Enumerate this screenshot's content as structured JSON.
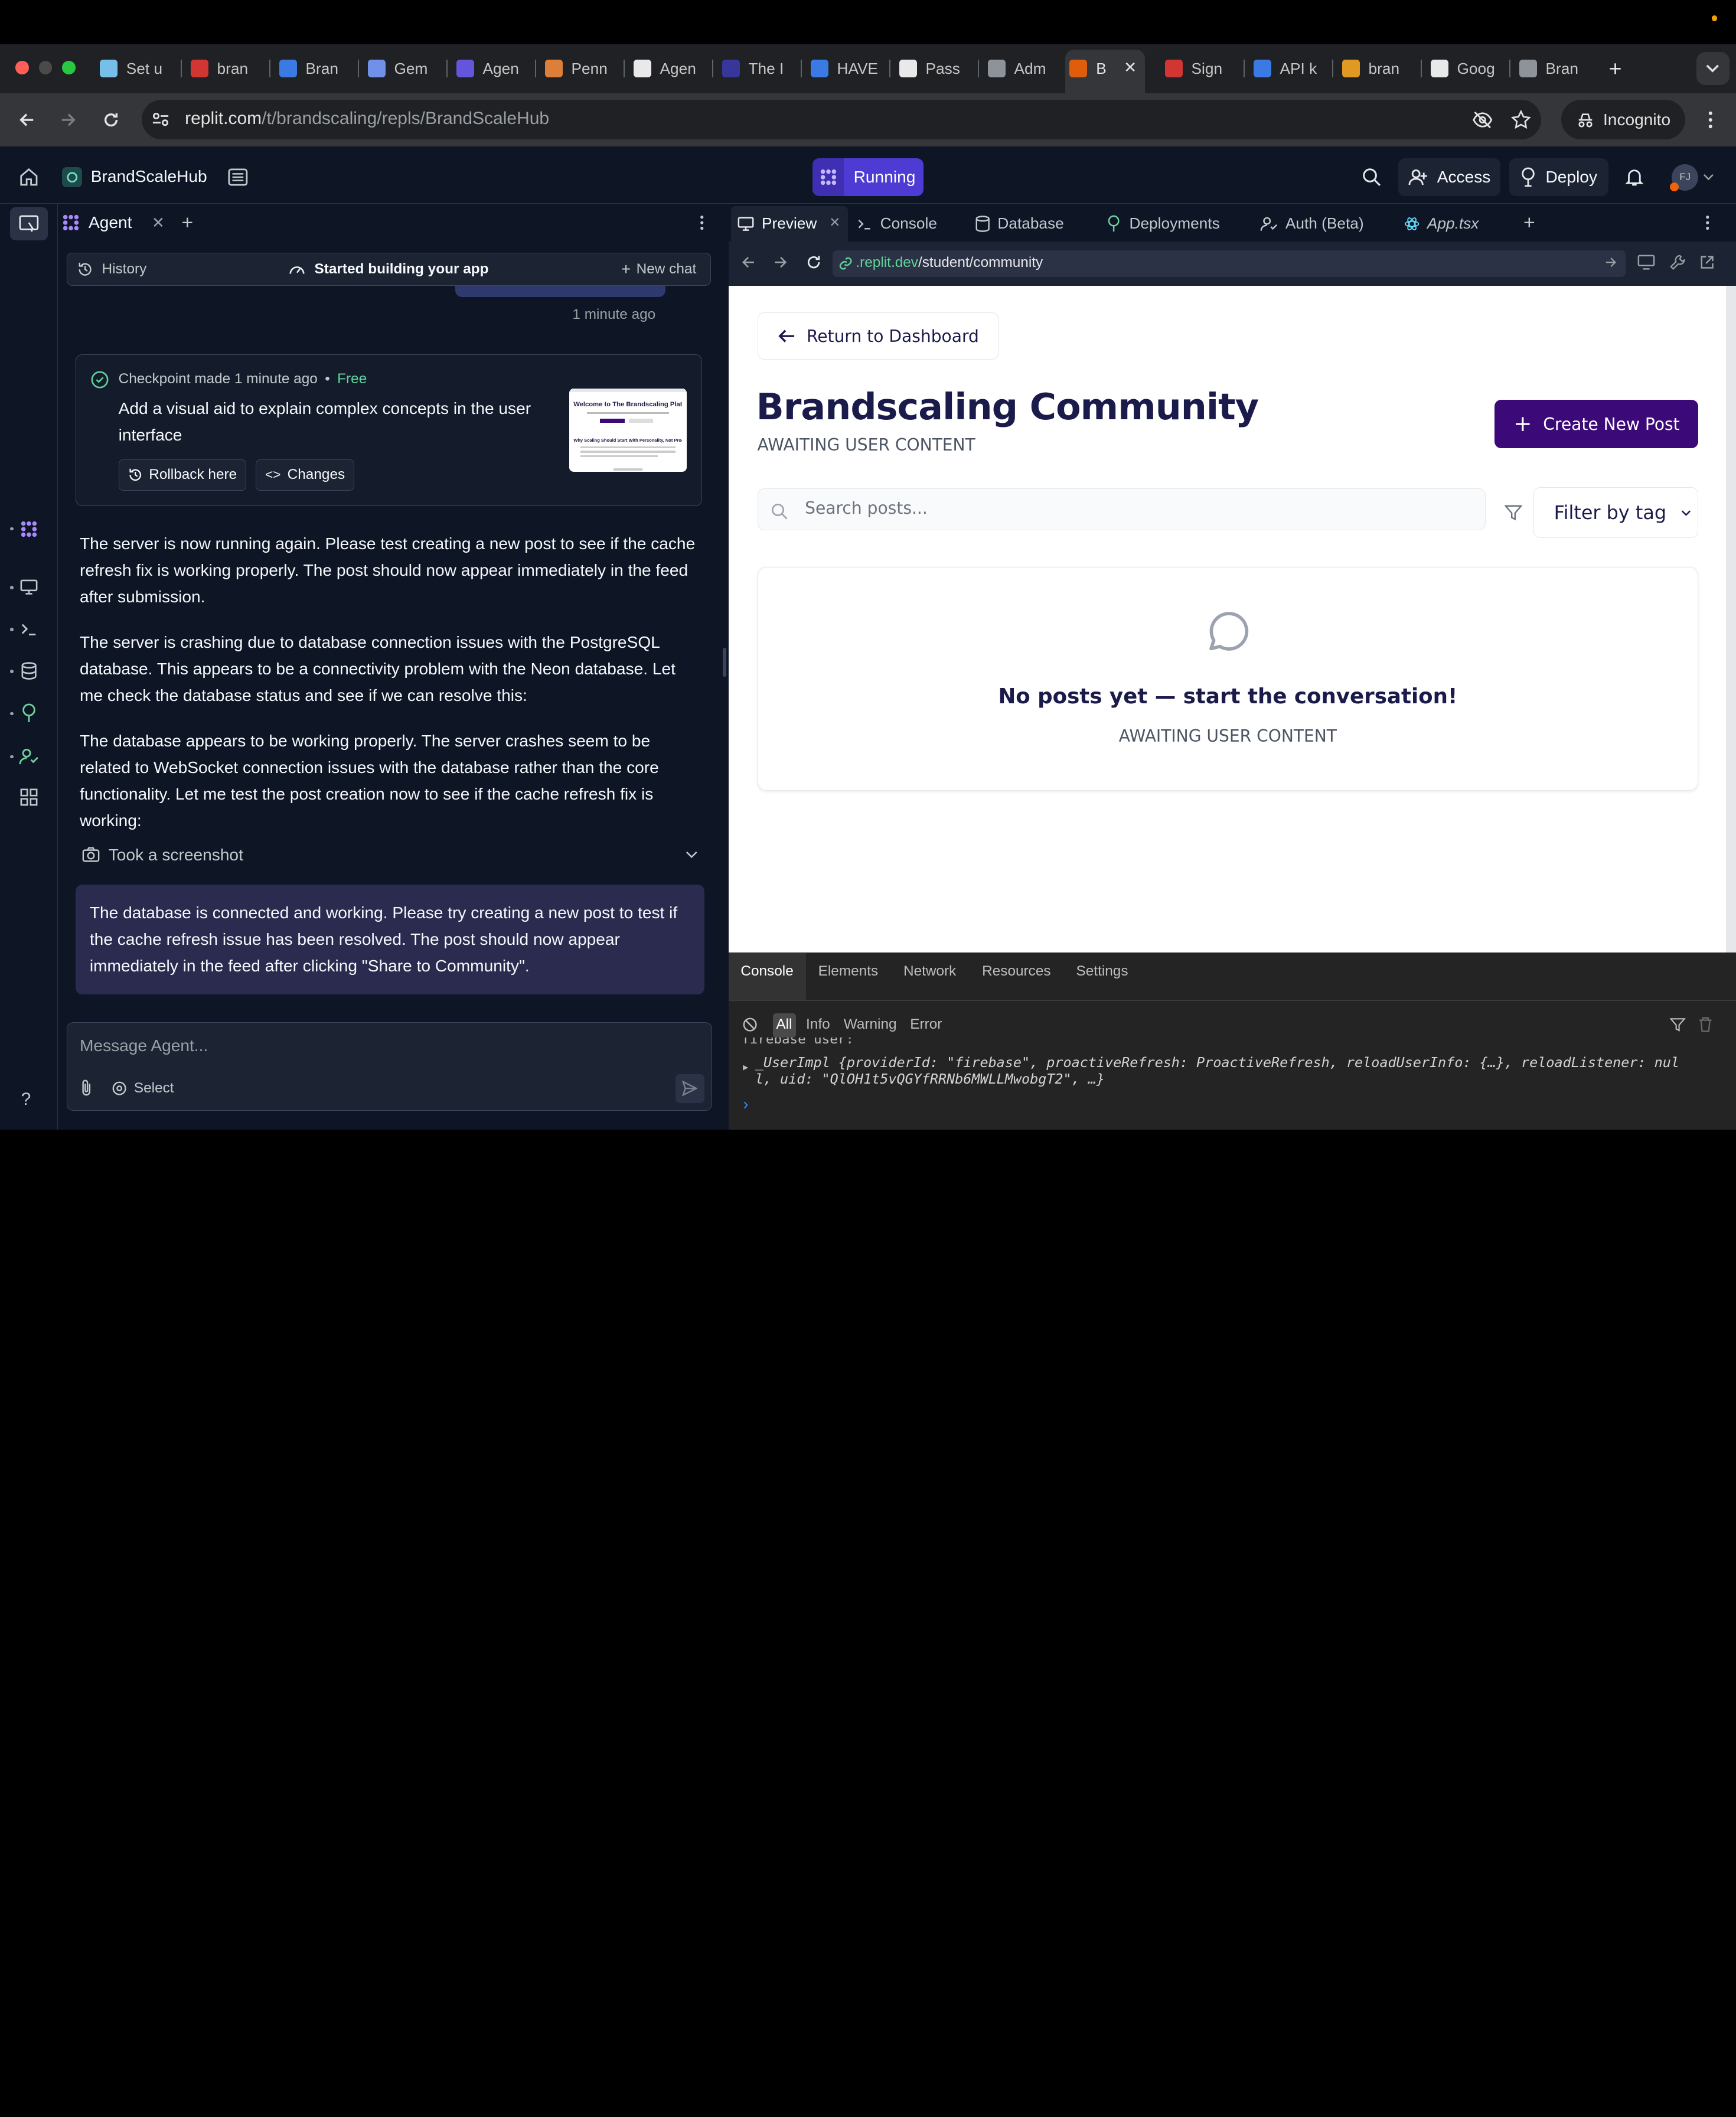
{
  "browser": {
    "tabs": [
      {
        "label": "Set u",
        "icon": "spiral-icon",
        "color": "#7fd0ff"
      },
      {
        "label": "bran",
        "icon": "doc-icon",
        "color": "#e53935"
      },
      {
        "label": "Bran",
        "icon": "dropbox-icon",
        "color": "#3d84f7"
      },
      {
        "label": "Gem",
        "icon": "gemini-icon",
        "color": "#7a9cff"
      },
      {
        "label": "Agen",
        "icon": "agent-icon",
        "color": "#6c5cf0"
      },
      {
        "label": "Penn",
        "icon": "hat-icon",
        "color": "#f08a3c"
      },
      {
        "label": "Agen",
        "icon": "triangle-icon",
        "color": "#ffffff"
      },
      {
        "label": "The I",
        "icon": "arc-icon",
        "color": "#3a3aa8"
      },
      {
        "label": "HAVE",
        "icon": "dropbox-icon",
        "color": "#3d84f7"
      },
      {
        "label": "Pass",
        "icon": "up-icon",
        "color": "#ffffff"
      },
      {
        "label": "Adm",
        "icon": "globe-icon",
        "color": "#9aa0a6"
      },
      {
        "label": "B",
        "icon": "replit-icon",
        "color": "#f26207",
        "active": true
      },
      {
        "label": "Sign",
        "icon": "flower-icon",
        "color": "#e53935"
      },
      {
        "label": "API k",
        "icon": "openai-icon",
        "color": "#3d84f7"
      },
      {
        "label": "bran",
        "icon": "flame-icon",
        "color": "#f5a623"
      },
      {
        "label": "Goog",
        "icon": "google-icon",
        "color": "#ffffff"
      },
      {
        "label": "Bran",
        "icon": "globe-icon",
        "color": "#9aa0a6"
      }
    ],
    "url_host": "replit.com",
    "url_path": "/t/brandscaling/repls/BrandScaleHub",
    "incognito_label": "Incognito"
  },
  "app": {
    "project_name": "BrandScaleHub",
    "status": "Running",
    "access_label": "Access",
    "deploy_label": "Deploy",
    "avatar_initials": "FJ"
  },
  "agent": {
    "tab_label": "Agent",
    "history_label": "History",
    "status_label": "Started building your app",
    "new_chat_label": "New chat",
    "timestamp": "1 minute ago",
    "checkpoint": {
      "title": "Checkpoint made",
      "time": "1 minute ago",
      "dot": "•",
      "badge": "Free",
      "description": "Add a visual aid to explain complex concepts in the user interface",
      "rollback_label": "Rollback here",
      "changes_label": "Changes",
      "thumb_title": "Welcome to The Brandscaling Platform",
      "thumb_sub": "Why Scaling Should Start With Personality, Not Process"
    },
    "messages": [
      "The server is now running again. Please test creating a new post to see if the cache refresh fix is working properly. The post should now appear immediately in the feed after submission.",
      "The server is crashing due to database connection issues with the PostgreSQL database. This appears to be a connectivity problem with the Neon database. Let me check the database status and see if we can resolve this:",
      "The database appears to be working properly. The server crashes seem to be related to WebSocket connection issues with the database rather than the core functionality. Let me test the post creation now to see if the cache refresh fix is working:"
    ],
    "screenshot_label": "Took a screenshot",
    "final_message": "The database is connected and working. Please try creating a new post to test if the cache refresh issue has been resolved. The post should now appear immediately in the feed after clicking \"Share to Community\".",
    "input_placeholder": "Message Agent...",
    "select_label": "Select"
  },
  "workspace": {
    "tabs": [
      "Preview",
      "Console",
      "Database",
      "Deployments",
      "Auth (Beta)",
      "App.tsx"
    ],
    "preview_url_host": ".replit.dev",
    "preview_url_path": "/student/community"
  },
  "page": {
    "back_label": "Return to Dashboard",
    "title": "Brandscaling Community",
    "subtitle": "AWAITING USER CONTENT",
    "create_label": "Create New Post",
    "search_placeholder": "Search posts...",
    "filter_label": "Filter by tag",
    "empty_title": "No posts yet — start the conversation!",
    "empty_sub": "AWAITING USER CONTENT",
    "accent": "#3b0a78",
    "title_color": "#1b1b4b"
  },
  "devtools": {
    "tabs": [
      "Console",
      "Elements",
      "Network",
      "Resources",
      "Settings"
    ],
    "filters": [
      "All",
      "Info",
      "Warning",
      "Error"
    ],
    "log_prefix": "firebase user:",
    "log_line1": "_UserImpl {providerId: \"firebase\", proactiveRefresh: ProactiveRefresh, reloadUserInfo: {…}, reloadListener: nul",
    "log_line2": "l, uid: \"QlOH1t5vQGYfRRNb6MWLLMwobgT2\", …}"
  }
}
